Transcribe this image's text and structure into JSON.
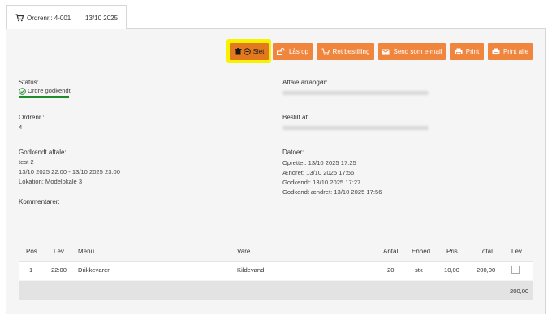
{
  "tab": {
    "order_label": "Ordrenr.: 4-001",
    "date": "13/10 2025"
  },
  "toolbar": {
    "delete_label": "Slet",
    "unlock_label": "Lås op",
    "edit_order_label": "Ret bestilling",
    "email_label": "Send som e-mail",
    "print_label": "Print",
    "print_all_label": "Print alle"
  },
  "details": {
    "status_label": "Status:",
    "status_value": "Ordre godkendt",
    "order_no_label": "Ordrenr.:",
    "order_no_value": "4",
    "approved_label": "Godkendt aftale:",
    "approved_name": "test 2",
    "approved_period": "13/10 2025 22:00 - 13/10 2025 23:00",
    "approved_location": "Lokation: Modelokale 3",
    "comments_label": "Kommentarer:",
    "organizer_label": "Aftale arrangør:",
    "ordered_by_label": "Bestilt af:",
    "dates_label": "Datoer:",
    "created": "Oprettet: 13/10 2025 17:25",
    "changed": "Ændret: 13/10 2025 17:56",
    "approved": "Godkendt: 13/10 2025 17:27",
    "approved_changed": "Godkendt ændret: 13/10 2025 17:56"
  },
  "table": {
    "headers": [
      "Pos",
      "Lev",
      "Menu",
      "Vare",
      "Antal",
      "Enhed",
      "Pris",
      "Total",
      "Lev."
    ],
    "rows": [
      [
        "1",
        "22:00",
        "Drikkevarer",
        "Kildevand",
        "20",
        "stk",
        "10,00",
        "200,00",
        ""
      ]
    ],
    "footer_total": "200,00"
  },
  "colors": {
    "button_orange": "#f0863e",
    "status_green": "#1f8c2a",
    "highlight_yellow": "#f6f200"
  }
}
